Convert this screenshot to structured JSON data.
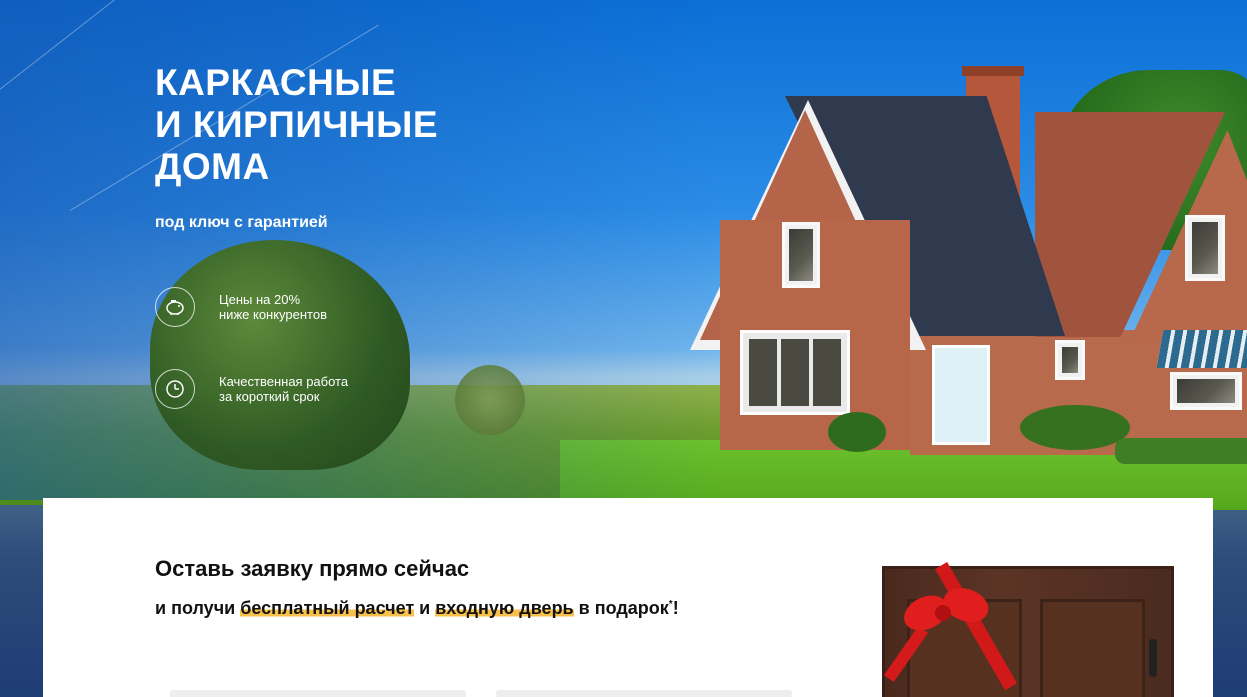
{
  "hero": {
    "title": "КАРКАСНЫЕ\nИ КИРПИЧНЫЕ\nДОМА",
    "subtitle": "под ключ с гарантией",
    "features": [
      {
        "icon": "piggy-bank-icon",
        "text": "Цены на 20%\nниже конкурентов"
      },
      {
        "icon": "clock-icon",
        "text": "Качественная работа\nза короткий срок"
      }
    ]
  },
  "form_card": {
    "title": "Оставь заявку прямо сейчас",
    "subtitle_prefix": "и получи ",
    "highlight_1": "бесплатный расчет",
    "subtitle_middle": " и ",
    "highlight_2": "входную дверь",
    "subtitle_suffix": " в подарок",
    "asterisk": "*",
    "exclamation": "!",
    "highlight_color": "#f6c04a",
    "gift_image": "door-with-red-bow"
  }
}
